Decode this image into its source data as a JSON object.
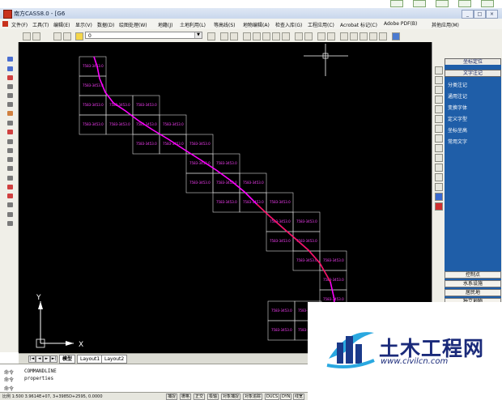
{
  "window": {
    "title": "南方CASS8.0 - [G6",
    "buttons": [
      "_",
      "□",
      "×"
    ]
  },
  "menu": {
    "items": [
      "文件(F)",
      "工具(T)",
      "编辑(E)",
      "显示(V)",
      "数据(D)",
      "绘图处理(W)",
      "地籍(J)",
      "土地利用(L)",
      "等高线(S)",
      "地物编辑(A)",
      "检查入库(G)",
      "工程应用(C)",
      "Acrobat 标记(C)",
      "Adobe PDF(B)",
      "其他应用(M)"
    ]
  },
  "toolbar": {
    "layer_value": "0"
  },
  "right_panel": {
    "header_top": "坐标定位",
    "header_second": "文字注记",
    "items": [
      "分类注记",
      "通用注记",
      "变换字体",
      "定义字型",
      "坐标坐高",
      "常用文字"
    ],
    "bottom_items": [
      "控制点",
      "水系设施",
      "居民地",
      "独立地物"
    ]
  },
  "tabs": {
    "nav": [
      "|◄",
      "◄",
      "►",
      "►|"
    ],
    "items": [
      "模型",
      "Layout1",
      "Layout2"
    ]
  },
  "command": {
    "lines": [
      {
        "label": "命令",
        "text": "COMMANDLINE"
      },
      {
        "label": "命令",
        "text": "properties"
      },
      {
        "label": "命令",
        "text": ""
      }
    ]
  },
  "status": {
    "coords": "比例 1:500 3.9614E+07, 3+3985D+2595, 0.0000",
    "buttons": [
      "捕捉",
      "栅格",
      "正交",
      "极轴",
      "对象捕捉",
      "对象追踪",
      "DUCS",
      "DYN",
      "线宽",
      "模型"
    ]
  },
  "ucs": {
    "y_label": "Y",
    "x_label": "X"
  },
  "grid_labels": {
    "sheet_number": "7583-3453.0"
  },
  "colors": {
    "canvas": "#000000",
    "route": "#ff00ff",
    "route_highlight": "#ff2020",
    "panel_blue": "#1f5ea8"
  },
  "watermark": {
    "name": "土木工程网",
    "url": "www.civilcn.com"
  }
}
